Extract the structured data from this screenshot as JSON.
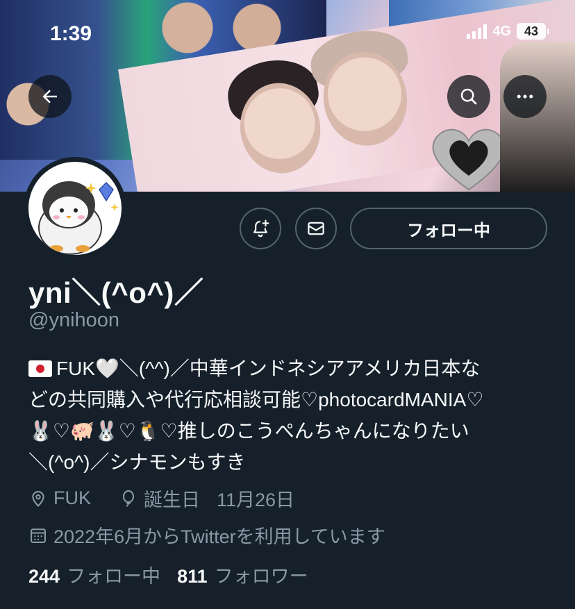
{
  "status_bar": {
    "time": "1:39",
    "network": "4G",
    "battery": "43"
  },
  "banner": {
    "icons": [
      "back-arrow-icon",
      "search-icon",
      "more-icon"
    ]
  },
  "profile": {
    "display_name": "yni＼(^o^)／",
    "handle": "@ynihoon",
    "bio_lines": [
      "FUK🤍＼(^^)／中華インドネシアアメリカ日本な",
      "どの共同購入や代行応相談可能♡photocardMANIA♡",
      "🐰♡🐖🐰♡🐧♡推しのこうぺんちゃんになりたい",
      "＼(^o^)／シナモンもすき"
    ],
    "location": "FUK",
    "birthday_label": "誕生日",
    "birthday_value": "11月26日",
    "joined": "2022年6月からTwitterを利用しています"
  },
  "buttons": {
    "follow_label": "フォロー中"
  },
  "stats": {
    "following_count": "244",
    "following_label": "フォロー中",
    "followers_count": "811",
    "followers_label": "フォロワー"
  },
  "colors": {
    "background": "#15202b",
    "text_primary": "#f7f9f9",
    "text_secondary": "#8b98a5",
    "border": "#536471"
  }
}
